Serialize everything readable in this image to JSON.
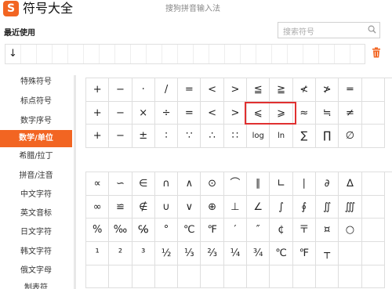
{
  "app": {
    "logo": "S",
    "title": "符号大全",
    "ime_title": "搜狗拼音输入法"
  },
  "recent": {
    "label": "最近使用",
    "items": [
      "↓",
      "",
      "",
      "",
      "",
      "",
      "",
      "",
      "",
      "",
      "",
      "",
      "",
      "",
      "",
      "",
      "",
      "",
      "",
      "",
      "",
      ""
    ]
  },
  "search": {
    "placeholder": "搜索符号"
  },
  "sidebar": {
    "items": [
      {
        "label": "特殊符号",
        "active": false
      },
      {
        "label": "标点符号",
        "active": false
      },
      {
        "label": "数字序号",
        "active": false
      },
      {
        "label": "数学/单位",
        "active": true
      },
      {
        "label": "希腊/拉丁",
        "active": false
      },
      {
        "label": "拼音/注音",
        "active": false
      },
      {
        "label": "中文字符",
        "active": false
      },
      {
        "label": "英文音标",
        "active": false
      },
      {
        "label": "日文字符",
        "active": false
      },
      {
        "label": "韩文字符",
        "active": false
      },
      {
        "label": "俄文字母",
        "active": false
      },
      {
        "label": "制表符",
        "active": false
      }
    ]
  },
  "panel1": {
    "rows": [
      [
        "+",
        "−",
        "·",
        "/",
        "=",
        "<",
        ">",
        "≦",
        "≧",
        "≮",
        "≯",
        "═",
        ""
      ],
      [
        "+",
        "−",
        "×",
        "÷",
        "=",
        "<",
        ">",
        "⩽",
        "⩾",
        "≈",
        "≒",
        "≠",
        ""
      ],
      [
        "+",
        "−",
        "±",
        "∶",
        "∵",
        "∴",
        "∷",
        "log",
        "ln",
        "∑",
        "∏",
        "∅",
        ""
      ]
    ]
  },
  "panel2": {
    "rows": [
      [
        "∝",
        "∽",
        "∈",
        "∩",
        "∧",
        "⊙",
        "⌒",
        "∥",
        "∟",
        "∣",
        "∂",
        "∆",
        ""
      ],
      [
        "∞",
        "≌",
        "∉",
        "∪",
        "∨",
        "⊕",
        "⊥",
        "∠",
        "∫",
        "∮",
        "∬",
        "∭",
        ""
      ],
      [
        "%",
        "‰",
        "℅",
        "°",
        "℃",
        "℉",
        "′",
        "″",
        "¢",
        "〒",
        "¤",
        "○",
        ""
      ],
      [
        "¹",
        "²",
        "³",
        "½",
        "⅓",
        "⅔",
        "¼",
        "¾",
        "℃",
        "℉",
        "┬",
        "",
        ""
      ],
      [
        "",
        "",
        "",
        "",
        "",
        "",
        "",
        "",
        "",
        "",
        "",
        "",
        ""
      ]
    ]
  },
  "colors": {
    "accent": "#f26522",
    "highlight": "#e03030"
  }
}
